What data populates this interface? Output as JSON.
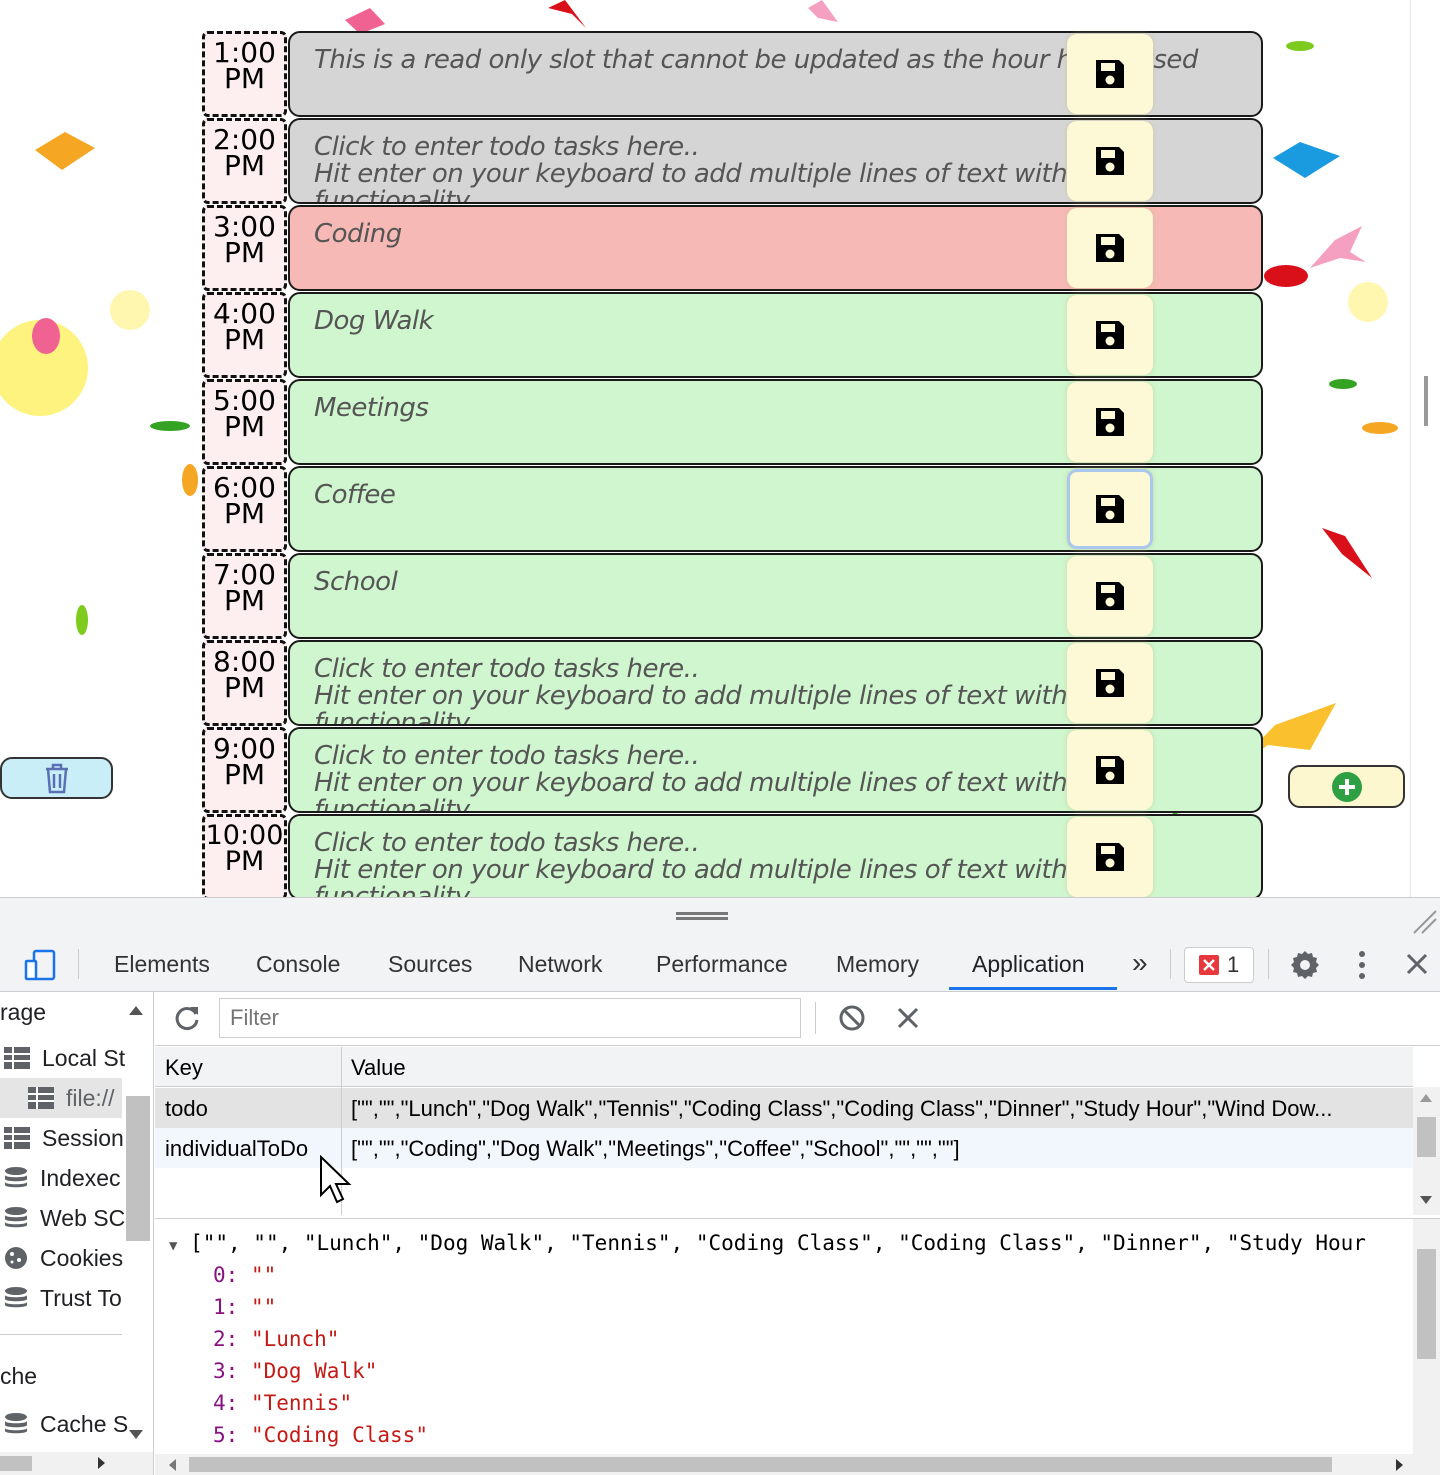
{
  "planner": {
    "placeholder": "Click to enter todo tasks here..\n Hit enter on your keyboard to add multiple lines of text with scroll functionality",
    "rows": [
      {
        "hour": "1:00",
        "ampm": "PM",
        "state": "past",
        "text": "This is a read only slot that cannot be updated as the hour has passed"
      },
      {
        "hour": "2:00",
        "ampm": "PM",
        "state": "past",
        "text": "Click to enter todo tasks here..\n Hit enter on your keyboard to add multiple lines of text with scroll functionality"
      },
      {
        "hour": "3:00",
        "ampm": "PM",
        "state": "present",
        "text": "Coding"
      },
      {
        "hour": "4:00",
        "ampm": "PM",
        "state": "future",
        "text": "Dog Walk"
      },
      {
        "hour": "5:00",
        "ampm": "PM",
        "state": "future",
        "text": "Meetings"
      },
      {
        "hour": "6:00",
        "ampm": "PM",
        "state": "future",
        "text": "Coffee"
      },
      {
        "hour": "7:00",
        "ampm": "PM",
        "state": "future",
        "text": "School"
      },
      {
        "hour": "8:00",
        "ampm": "PM",
        "state": "future",
        "text": "Click to enter todo tasks here..\n Hit enter on your keyboard to add multiple lines of text with scroll functionality"
      },
      {
        "hour": "9:00",
        "ampm": "PM",
        "state": "future",
        "text": "Click to enter todo tasks here..\n Hit enter on your keyboard to add multiple lines of text with scroll functionality"
      },
      {
        "hour": "10:00",
        "ampm": "PM",
        "state": "future",
        "text": "Click to enter todo tasks here..\n Hit enter on your keyboard to add multiple lines of text with scroll functionality"
      }
    ],
    "save_icon": "floppy-disk-icon",
    "trash_icon": "trash-icon",
    "add_icon": "plus-circle-icon"
  },
  "devtools": {
    "tabs": [
      "Elements",
      "Console",
      "Sources",
      "Network",
      "Performance",
      "Memory",
      "Application"
    ],
    "active_tab": "Application",
    "more_icon": "»",
    "error_count": "1",
    "sidebar": {
      "section_storage": "rage",
      "local_storage": "Local St",
      "local_storage_child": "file://",
      "session_storage": "Session",
      "indexeddb": "Indexec",
      "websql": "Web SC",
      "cookies": "Cookies",
      "trust_tokens": "Trust To",
      "section_cache": "che",
      "cache_storage": "Cache S"
    },
    "filter_placeholder": "Filter",
    "table": {
      "col_key": "Key",
      "col_value": "Value",
      "rows": [
        {
          "key": "todo",
          "value": "[\"\",\"\",\"Lunch\",\"Dog Walk\",\"Tennis\",\"Coding Class\",\"Coding Class\",\"Dinner\",\"Study Hour\",\"Wind Dow..."
        },
        {
          "key": "individualToDo",
          "value": "[\"\",\"\",\"Coding\",\"Dog Walk\",\"Meetings\",\"Coffee\",\"School\",\"\",\"\",\"\"]"
        }
      ]
    },
    "preview": {
      "summary": "[\"\", \"\", \"Lunch\", \"Dog Walk\", \"Tennis\", \"Coding Class\", \"Coding Class\", \"Dinner\", \"Study Hour",
      "items": [
        {
          "idx": "0:",
          "val": "\"\""
        },
        {
          "idx": "1:",
          "val": "\"\""
        },
        {
          "idx": "2:",
          "val": "\"Lunch\""
        },
        {
          "idx": "3:",
          "val": "\"Dog Walk\""
        },
        {
          "idx": "4:",
          "val": "\"Tennis\""
        },
        {
          "idx": "5:",
          "val": "\"Coding Class\""
        }
      ]
    }
  },
  "colors": {
    "past": "#d5d5d5",
    "present": "#f6b9b5",
    "future": "#cff6ce",
    "save_bg": "#fdf8d6",
    "accent": "#1a73e8"
  }
}
